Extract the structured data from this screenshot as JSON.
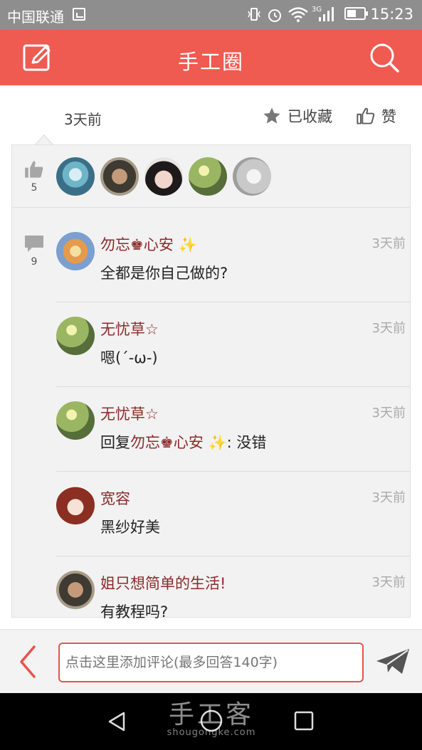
{
  "status_bar": {
    "carrier": "中国联通",
    "time": "15:23",
    "network": "3G"
  },
  "header": {
    "title": "手工圈",
    "left_icon": "edit-icon",
    "right_icon": "search-icon",
    "color": "#ef5a51"
  },
  "post_meta": {
    "time_ago": "3天前",
    "favorite_label": "已收藏",
    "like_label": "赞"
  },
  "likes": {
    "count": "5",
    "avatars": [
      "avatar-1",
      "avatar-2",
      "avatar-3",
      "avatar-4",
      "avatar-5"
    ]
  },
  "comments": {
    "count": "9",
    "items": [
      {
        "name": "勿忘♚心安",
        "name_badge": "✨",
        "time": "3天前",
        "text": "全都是你自己做的?"
      },
      {
        "name": "无忧草☆",
        "time": "3天前",
        "text": "嗯(´-ω-)"
      },
      {
        "name": "无忧草☆",
        "time": "3天前",
        "text_prefix": "回复",
        "reply_to": "勿忘♚心安",
        "reply_badge": "✨",
        "text_suffix": ": 没错"
      },
      {
        "name": "宽容",
        "time": "3天前",
        "text": "黑纱好美"
      },
      {
        "name": "姐只想简单的生活!",
        "time": "3天前",
        "text": "有教程吗?"
      }
    ]
  },
  "input_bar": {
    "placeholder": "点击这里添加评论(最多回答140字)"
  },
  "watermark": {
    "title": "手工客",
    "url": "shougongke.com"
  },
  "colors": {
    "accent": "#ef5a51",
    "username": "#8b2a2a"
  }
}
